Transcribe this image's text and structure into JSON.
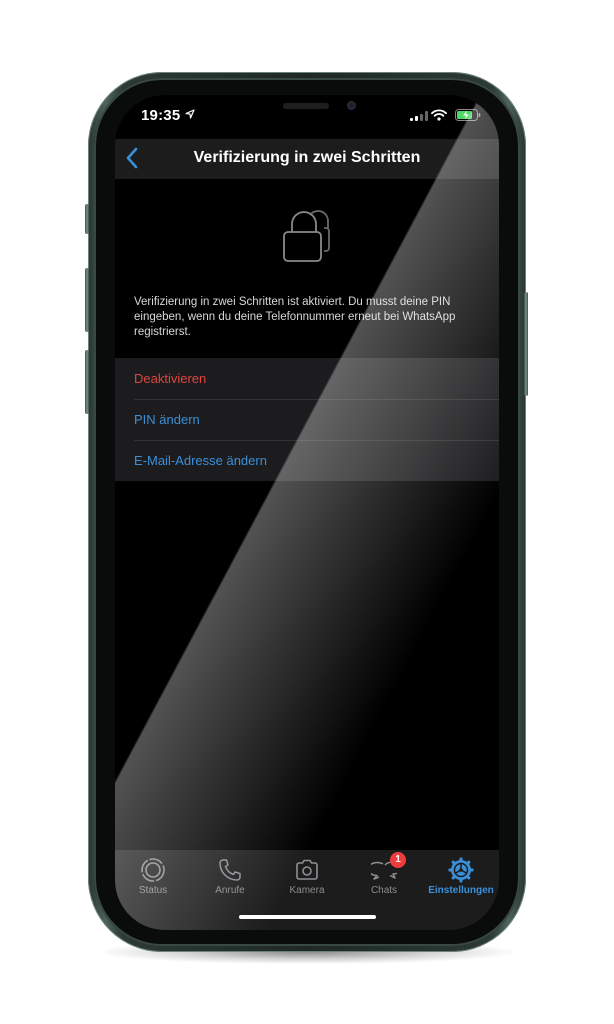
{
  "status_bar": {
    "time": "19:35",
    "icons": [
      "location-arrow-icon",
      "cellular-signal-icon",
      "wifi-icon",
      "battery-charging-icon"
    ]
  },
  "nav": {
    "back_icon": "chevron-left-icon",
    "title": "Verifizierung in zwei Schritten"
  },
  "hero": {
    "icon": "lock-icon",
    "description": "Verifizierung in zwei Schritten ist aktiviert. Du musst deine PIN eingeben, wenn du deine Telefonnummer erneut bei WhatsApp registrierst."
  },
  "menu": {
    "items": [
      {
        "label": "Deaktivieren",
        "color": "#e0453f"
      },
      {
        "label": "PIN ändern",
        "color": "#3a8fd9"
      },
      {
        "label": "E-Mail-Adresse ändern",
        "color": "#3a8fd9"
      }
    ]
  },
  "tabbar": {
    "tabs": [
      {
        "label": "Status",
        "icon": "status-icon",
        "active": false
      },
      {
        "label": "Anrufe",
        "icon": "phone-icon",
        "active": false
      },
      {
        "label": "Kamera",
        "icon": "camera-icon",
        "active": false
      },
      {
        "label": "Chats",
        "icon": "chat-bubbles-icon",
        "active": false,
        "badge": "1"
      },
      {
        "label": "Einstellungen",
        "icon": "settings-gear-icon",
        "active": true
      }
    ]
  },
  "colors": {
    "accent": "#3a8fd9",
    "destructive": "#e0453f",
    "badge": "#ee3b3b",
    "battery": "#4cd964"
  }
}
